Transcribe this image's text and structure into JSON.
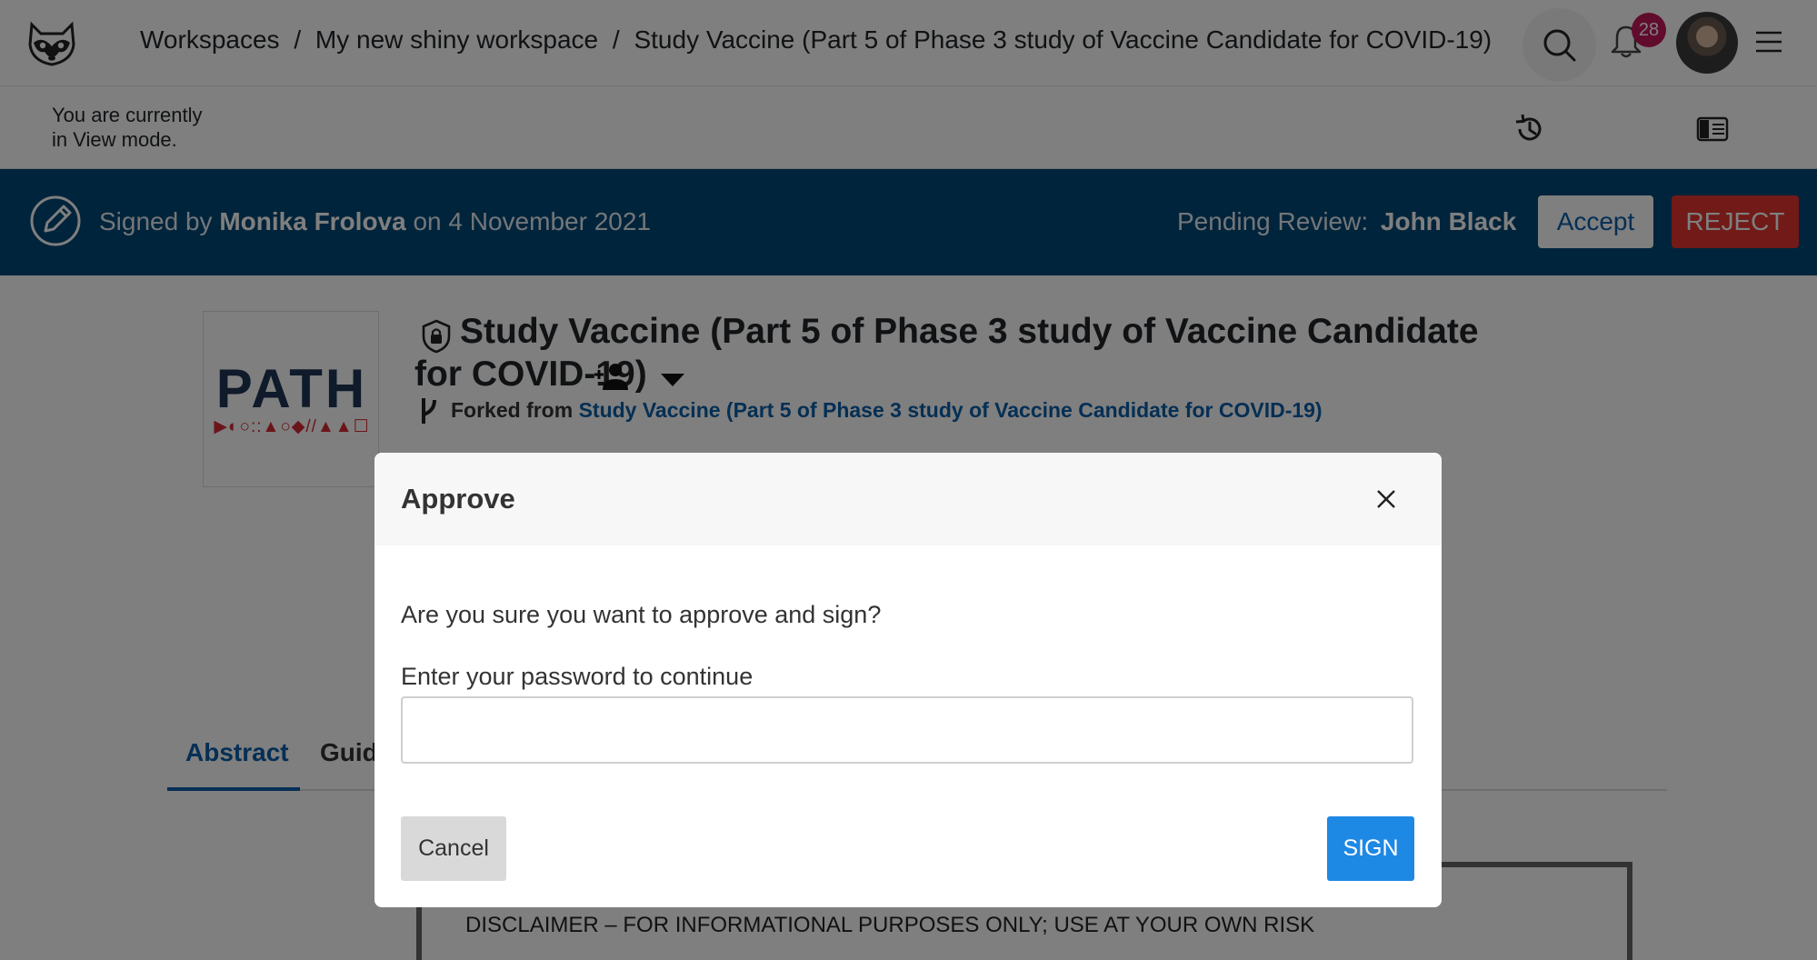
{
  "header": {
    "breadcrumbs": [
      "Workspaces",
      "My new shiny workspace",
      "Study Vaccine (Part 5 of Phase 3 study of Vaccine Candidate for COVID-19)"
    ],
    "separator": "/",
    "notification_count": "28"
  },
  "mode": {
    "line1": "You are currently",
    "line2": "in View mode."
  },
  "signature": {
    "prefix": "Signed by",
    "signer": "Monika Frolova",
    "date_text": "on 4 November 2021",
    "pending_label": "Pending Review:",
    "pending_reviewer": "John Black",
    "accept_label": "Accept",
    "reject_label": "REJECT"
  },
  "study": {
    "logo_word": "PATH",
    "logo_marks": "▶◐○::▲○◆//▲▲☐",
    "title": "Study Vaccine (Part 5 of Phase 3 study of Vaccine Candidate for COVID-19)",
    "forked_label": "Forked from",
    "forked_link": "Study Vaccine (Part 5 of Phase 3 study of Vaccine Candidate for COVID-19)"
  },
  "tabs": {
    "abstract": "Abstract",
    "guide_visible": "Guid"
  },
  "document": {
    "disclaimer": "DISCLAIMER – FOR INFORMATIONAL PURPOSES ONLY; USE AT YOUR OWN RISK"
  },
  "modal": {
    "title": "Approve",
    "question": "Are you sure you want to approve and sign?",
    "password_label": "Enter your password to continue",
    "password_value": "",
    "cancel_label": "Cancel",
    "sign_label": "SIGN"
  },
  "colors": {
    "signature_bar": "#004877",
    "accent": "#0b5ea8",
    "reject": "#e3342f",
    "sign": "#1e88e5",
    "badge": "#c2185b"
  },
  "icons": [
    "raccoon-logo-icon",
    "search-icon",
    "bell-icon",
    "hamburger-menu-icon",
    "history-icon",
    "side-panel-icon",
    "pen-sign-icon",
    "shield-lock-icon",
    "add-user-icon",
    "caret-down-icon",
    "fork-icon",
    "close-icon"
  ]
}
